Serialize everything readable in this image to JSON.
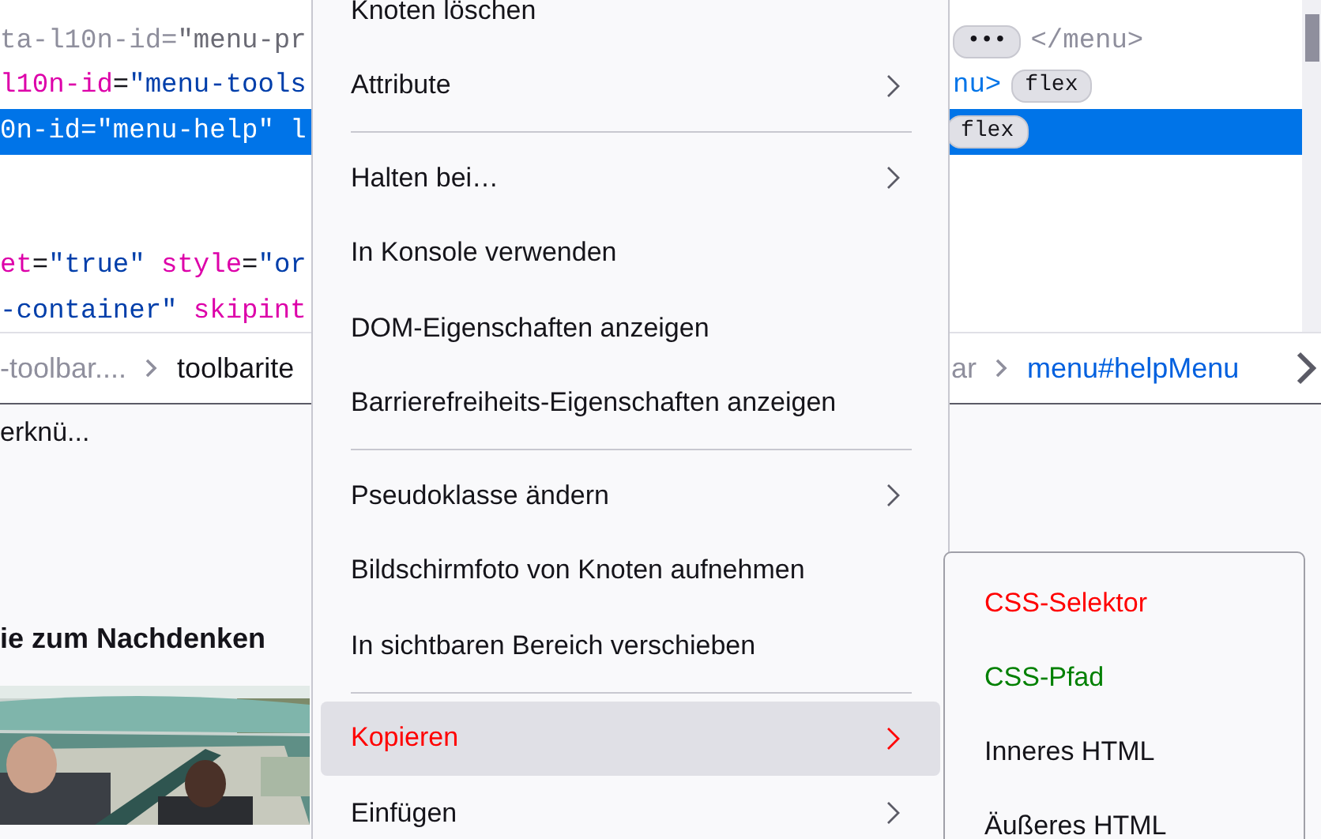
{
  "code_lines": [
    {
      "selected": false,
      "left": [
        {
          "kind": "faded",
          "text": "ta-l10n-id="
        },
        {
          "kind": "faded-value",
          "text": "\"menu-pr"
        }
      ],
      "right": [
        {
          "kind": "badge",
          "text": "•••"
        },
        {
          "kind": "faded",
          "text": "</menu>"
        }
      ]
    },
    {
      "selected": false,
      "left": [
        {
          "kind": "name",
          "text": "l10n-id"
        },
        {
          "kind": "punct",
          "text": "="
        },
        {
          "kind": "value",
          "text": "\"menu-tools"
        }
      ],
      "right": [
        {
          "kind": "tag",
          "text": "nu>"
        },
        {
          "kind": "badge",
          "text": "flex"
        }
      ]
    },
    {
      "selected": true,
      "left": [
        {
          "kind": "value",
          "text": "0n-id=\"menu-help\" l"
        }
      ],
      "right": [
        {
          "kind": "badge",
          "text": "flex"
        }
      ]
    },
    {
      "selected": false
    },
    {
      "selected": false
    },
    {
      "selected": false,
      "left": [
        {
          "kind": "name",
          "text": "et"
        },
        {
          "kind": "punct",
          "text": "="
        },
        {
          "kind": "value",
          "text": "\"true\""
        },
        {
          "kind": "name",
          "text": " style"
        },
        {
          "kind": "punct",
          "text": "="
        },
        {
          "kind": "value",
          "text": "\"or"
        }
      ]
    },
    {
      "selected": false,
      "left": [
        {
          "kind": "value",
          "text": "-container\""
        },
        {
          "kind": "name",
          "text": " skipint"
        }
      ]
    }
  ],
  "breadcrumbs": {
    "left": [
      {
        "label": "-toolbar....",
        "selected": false
      },
      {
        "label": "toolbarite",
        "selected": false
      }
    ],
    "right": [
      {
        "label": "ar",
        "selected": false
      },
      {
        "label": "menu#helpMenu",
        "selected": true
      }
    ]
  },
  "page": {
    "snippet": "erknü...",
    "heading": "ie zum Nachdenken"
  },
  "context_menu": [
    {
      "kind": "item",
      "label": "Knoten löschen",
      "submenu": false,
      "selected": false
    },
    {
      "kind": "item",
      "label": "Attribute",
      "submenu": true,
      "selected": false
    },
    {
      "kind": "separator"
    },
    {
      "kind": "item",
      "label": "Halten bei…",
      "submenu": true,
      "selected": false
    },
    {
      "kind": "item",
      "label": "In Konsole verwenden",
      "submenu": false,
      "selected": false
    },
    {
      "kind": "item",
      "label": "DOM-Eigenschaften anzeigen",
      "submenu": false,
      "selected": false
    },
    {
      "kind": "item",
      "label": "Barrierefreiheits-Eigenschaften anzeigen",
      "submenu": false,
      "selected": false
    },
    {
      "kind": "separator"
    },
    {
      "kind": "item",
      "label": "Pseudoklasse ändern",
      "submenu": true,
      "selected": false
    },
    {
      "kind": "item",
      "label": "Bildschirmfoto von Knoten aufnehmen",
      "submenu": false,
      "selected": false
    },
    {
      "kind": "item",
      "label": "In sichtbaren Bereich verschieben",
      "submenu": false,
      "selected": false
    },
    {
      "kind": "separator"
    },
    {
      "kind": "item",
      "label": "Kopieren",
      "submenu": true,
      "selected": true,
      "color": "#ff0000"
    },
    {
      "kind": "item",
      "label": "Einfügen",
      "submenu": true,
      "selected": false
    }
  ],
  "copy_submenu": [
    {
      "label": "CSS-Selektor",
      "color": "#ff0000"
    },
    {
      "label": "CSS-Pfad",
      "color": "#008000"
    },
    {
      "label": "Inneres HTML",
      "color": "#15141a"
    },
    {
      "label": "Äußeres HTML",
      "color": "#15141a"
    }
  ]
}
